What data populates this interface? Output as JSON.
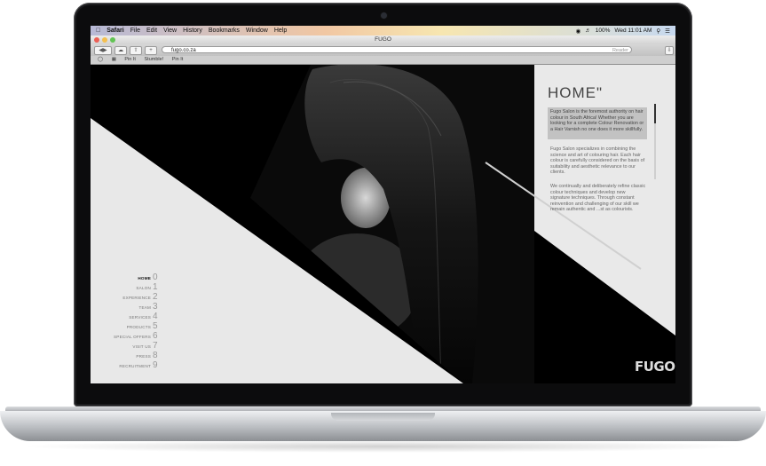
{
  "menubar": {
    "app": "Safari",
    "items": [
      "File",
      "Edit",
      "View",
      "History",
      "Bookmarks",
      "Window",
      "Help"
    ],
    "battery": "100%",
    "clock": "Wed 11:01 AM"
  },
  "window": {
    "title": "FUGO",
    "url": "fugo.co.za",
    "reader_label": "Reader"
  },
  "bookmarks": [
    "Pin It",
    "Stumble!",
    "Pin It"
  ],
  "site": {
    "heading": "HOME\"",
    "intro": "Fugo Salon is the foremost authority on hair colour in South Africa! Whether you are looking for a complete Colour Renovation or a Hair Varnish no one does it more skillfully.",
    "para1": "Fugo Salon specializes in combining the science and art of colouring hair.  Each hair colour is carefully considered on the basis of suitability and aesthetic relevance to our clients.",
    "para2": "We continually and deliberately refine classic colour techniques and develop new signature techniques.  Through constant reinvention and challenging of our skill we remain authentic and ...st as colourists.",
    "big_number": "2",
    "logo": "FUGO",
    "nav": [
      {
        "label": "HOME",
        "num": "0"
      },
      {
        "label": "SALON",
        "num": "1"
      },
      {
        "label": "EXPERIENCE",
        "num": "2"
      },
      {
        "label": "TEAM",
        "num": "3"
      },
      {
        "label": "SERVICES",
        "num": "4"
      },
      {
        "label": "PRODUCTS",
        "num": "5"
      },
      {
        "label": "SPECIAL OFFERS",
        "num": "6"
      },
      {
        "label": "VISIT US",
        "num": "7"
      },
      {
        "label": "PRESS",
        "num": "8"
      },
      {
        "label": "RECRUITMENT",
        "num": "9"
      }
    ]
  },
  "colors": {
    "traffic_close": "#ec5f55",
    "traffic_min": "#f4bf4f",
    "traffic_max": "#62c454",
    "page_light": "#e8e8e8",
    "page_dark": "#000000"
  }
}
